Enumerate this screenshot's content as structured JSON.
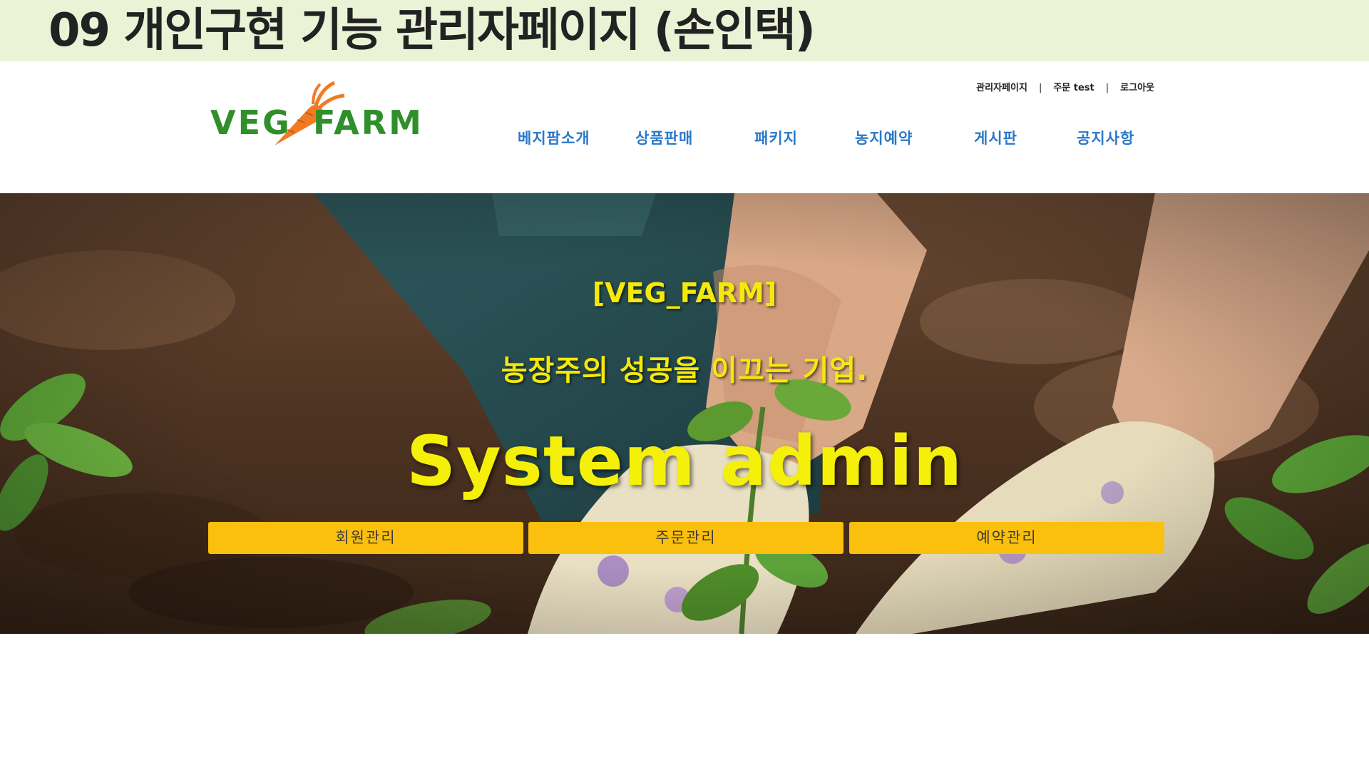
{
  "slide": {
    "title": "09 개인구현 기능  관리자페이지 (손인택)"
  },
  "site": {
    "logo_text_left": "VEG",
    "logo_text_right": "FARM",
    "util_links": [
      "관리자페이지",
      "주문 test",
      "로그아웃"
    ],
    "util_separator": "|",
    "nav": [
      "베지팜소개",
      "상품판매",
      "패키지",
      "농지예약",
      "게시판",
      "공지사항"
    ],
    "colors": {
      "logo_green": "#2f8f2a",
      "carrot_orange": "#f07b22",
      "nav_blue": "#2a78c8",
      "hero_text_yellow": "#f5e90a",
      "button_yellow": "#fbbf0d",
      "slide_header_bg": "#eaf3d6"
    }
  },
  "hero": {
    "brand": "[VEG_FARM]",
    "slogan": "농장주의 성공을 이끄는 기업.",
    "title": "System admin",
    "buttons": [
      "회원관리",
      "주문관리",
      "예약관리"
    ]
  }
}
